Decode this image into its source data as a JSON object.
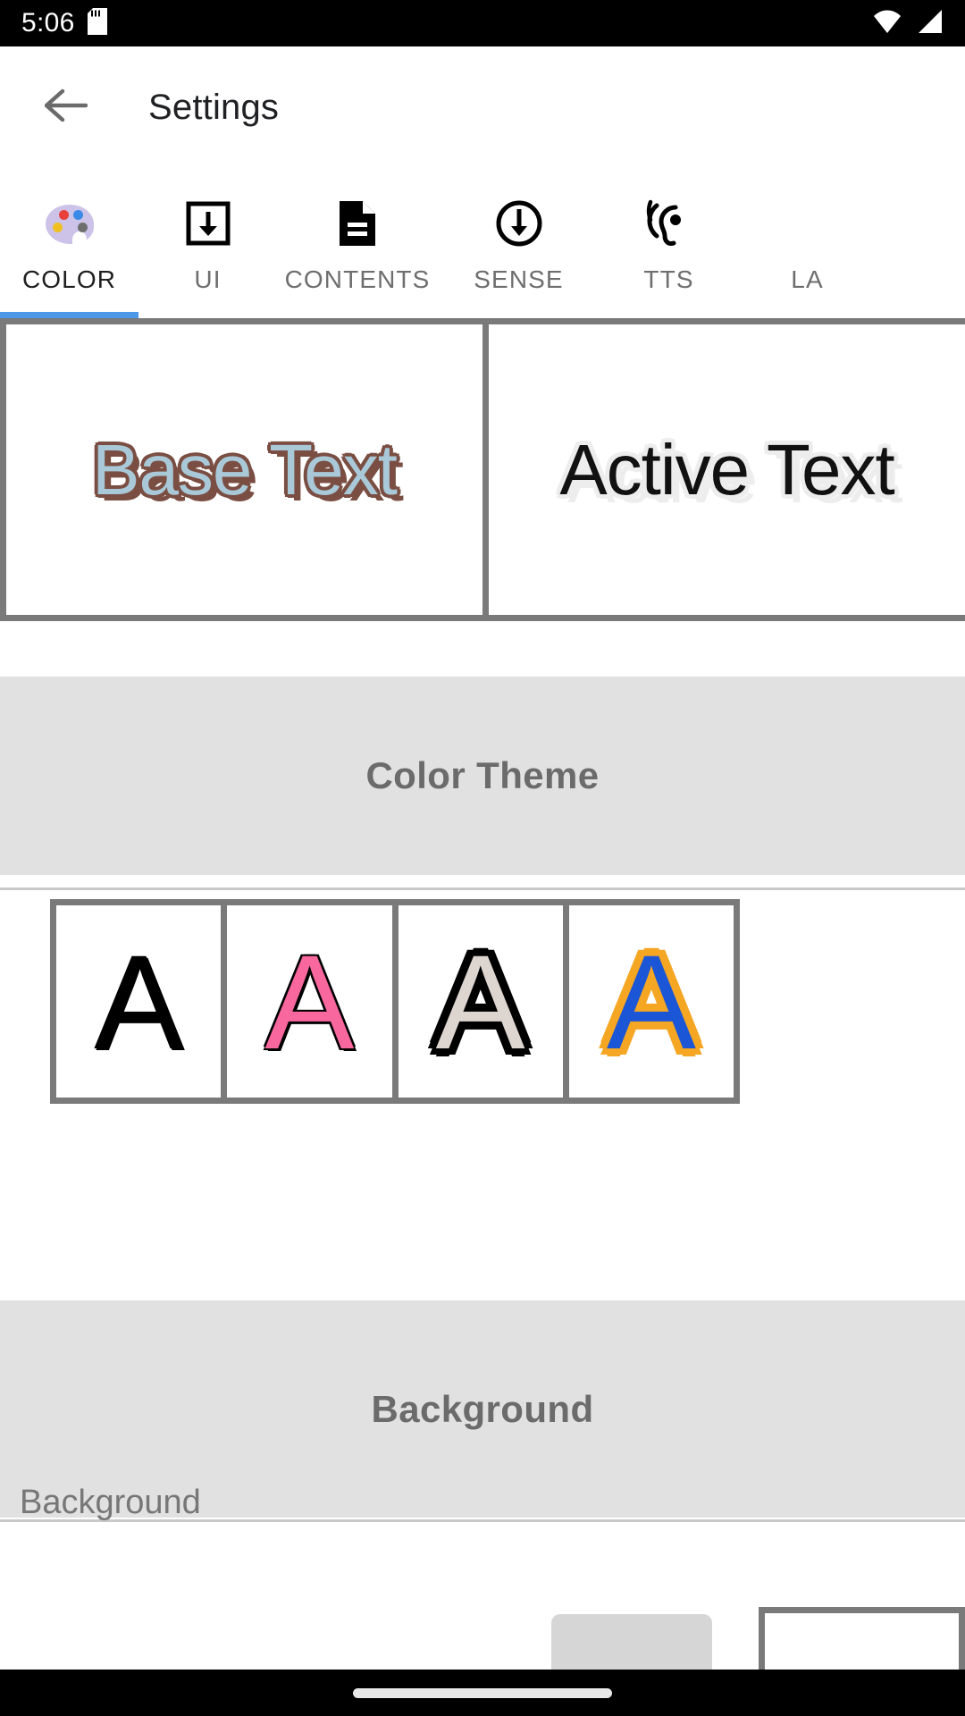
{
  "statusbar": {
    "time": "5:06",
    "icons": [
      "sd-card-icon",
      "wifi-icon",
      "signal-icon"
    ]
  },
  "appbar": {
    "back_icon": "back-arrow-icon",
    "title": "Settings"
  },
  "tabs": {
    "active_index": 0,
    "indicator_color": "#4d97e8",
    "items": [
      {
        "label": "COLOR",
        "icon": "color-palette-icon"
      },
      {
        "label": "UI",
        "icon": "download-box-icon"
      },
      {
        "label": "CONTENTS",
        "icon": "document-icon"
      },
      {
        "label": "SENSE",
        "icon": "circle-down-arrow-icon"
      },
      {
        "label": "TTS",
        "icon": "hearing-ear-icon"
      },
      {
        "label": "LA",
        "icon": "truncated-tab-icon"
      }
    ]
  },
  "preview": {
    "panels": [
      {
        "text": "Base Text",
        "fill_color": "#a9c8d8",
        "outline_color": "#7a4e42"
      },
      {
        "text": "Active Text",
        "fill_color": "#111111",
        "outline_color": "#ededed"
      }
    ]
  },
  "sections": {
    "color_theme": {
      "title": "Color Theme"
    },
    "background": {
      "title": "Background"
    }
  },
  "color_theme": {
    "swatches": [
      {
        "glyph": "A",
        "fill_color": "#000000",
        "outline_color": "#000000",
        "selected": false
      },
      {
        "glyph": "A",
        "fill_color": "#f9679f",
        "outline_color": "#000000",
        "selected": false
      },
      {
        "glyph": "A",
        "fill_color": "#ddd5d0",
        "outline_color": "#000000",
        "selected": false
      },
      {
        "glyph": "A",
        "fill_color": "#1a56d6",
        "outline_color": "#f5a623",
        "selected": false
      }
    ]
  },
  "background_row": {
    "label": "Background",
    "chip_color": "#d6d6d6",
    "preview_border_color": "#7a7a7a"
  },
  "navbar": {
    "home_indicator": "home-indicator"
  },
  "colors": {
    "accent": "#4d97e8",
    "panel_border": "#7a7a7a",
    "section_bg": "#e1e1e1",
    "section_text": "#6b6b6b"
  }
}
